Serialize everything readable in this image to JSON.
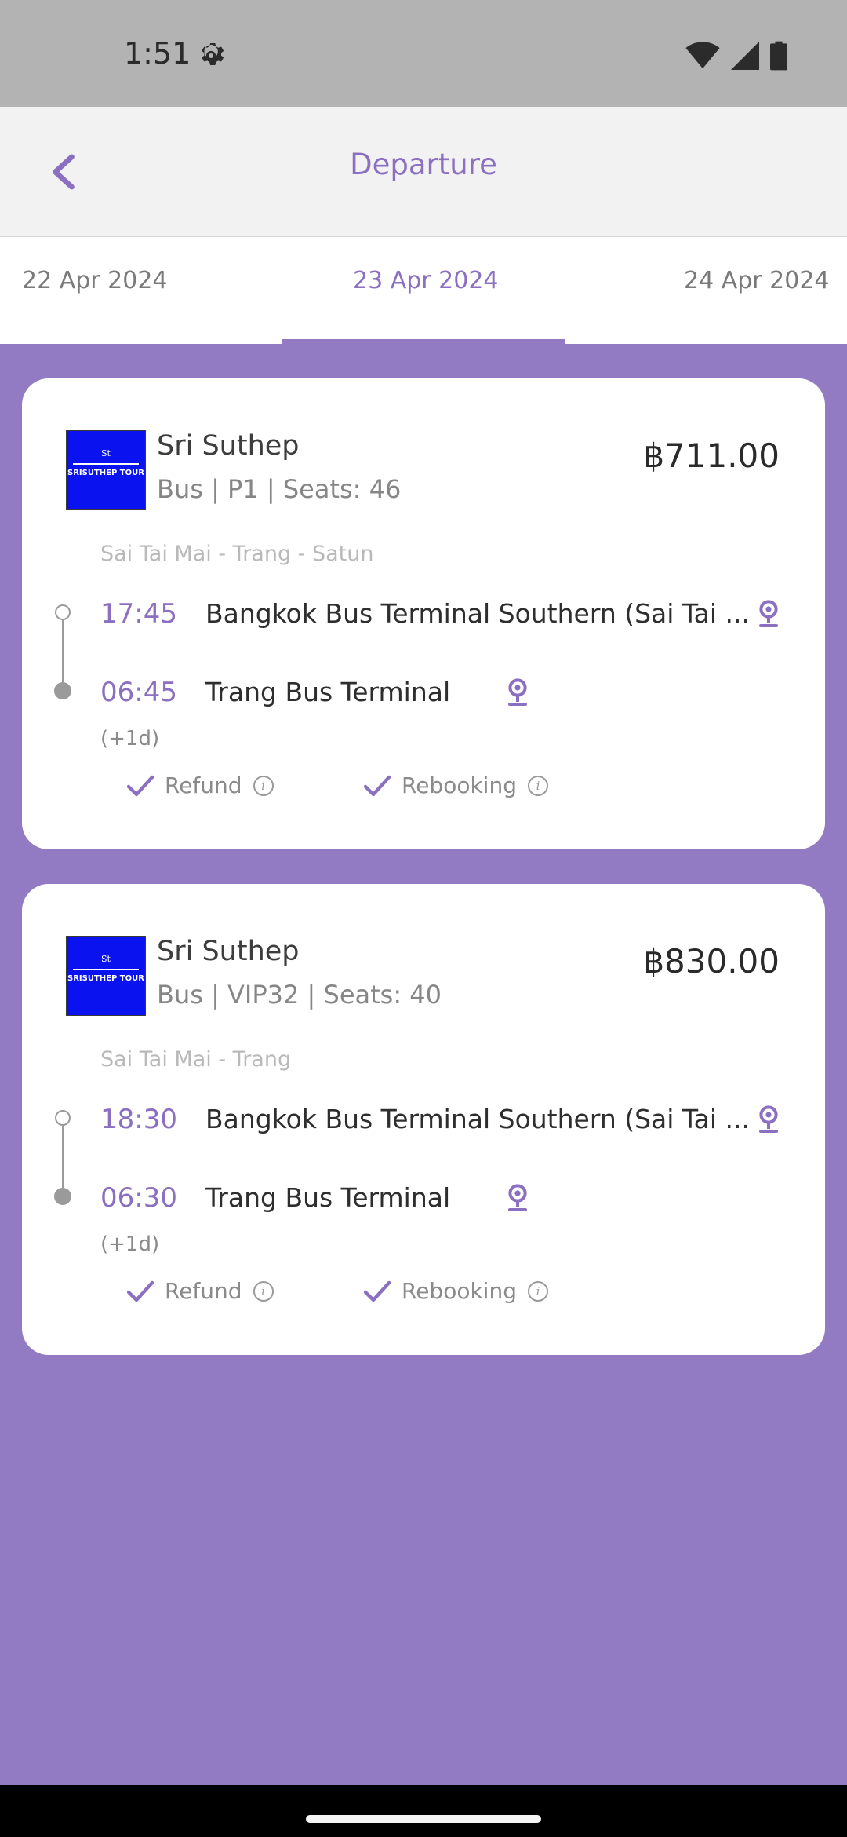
{
  "status_bar": {
    "time": "1:51"
  },
  "app_bar": {
    "title": "Departure"
  },
  "date_tabs": [
    {
      "label": "22 Apr 2024",
      "active": false
    },
    {
      "label": "23 Apr 2024",
      "active": true
    },
    {
      "label": "24 Apr 2024",
      "active": false
    }
  ],
  "trips": [
    {
      "logo": {
        "monogram": "St",
        "text": "SRISUTHEP TOUR"
      },
      "operator": "Sri Suthep",
      "details": "Bus | P1 | Seats: 46",
      "price": "฿711.00",
      "route": "Sai Tai Mai - Trang - Satun",
      "departure": {
        "time": "17:45",
        "stop": "Bangkok Bus Terminal Southern (Sai Tai ..."
      },
      "arrival": {
        "time": "06:45",
        "stop": "Trang Bus Terminal",
        "day_offset": "(+1d)"
      },
      "refund_label": "Refund",
      "rebooking_label": "Rebooking"
    },
    {
      "logo": {
        "monogram": "St",
        "text": "SRISUTHEP TOUR"
      },
      "operator": "Sri Suthep",
      "details": "Bus | VIP32 | Seats: 40",
      "price": "฿830.00",
      "route": "Sai Tai Mai - Trang",
      "departure": {
        "time": "18:30",
        "stop": "Bangkok Bus Terminal Southern (Sai Tai ..."
      },
      "arrival": {
        "time": "06:30",
        "stop": "Trang Bus Terminal",
        "day_offset": "(+1d)"
      },
      "refund_label": "Refund",
      "rebooking_label": "Rebooking"
    }
  ],
  "colors": {
    "accent": "#8b6fc0",
    "background": "#937bc4",
    "logo_blue": "#0a12f0"
  },
  "icons": [
    "settings-gear-icon",
    "wifi-icon",
    "signal-icon",
    "battery-icon",
    "back-arrow-icon",
    "map-pin-icon",
    "check-icon",
    "info-icon"
  ]
}
